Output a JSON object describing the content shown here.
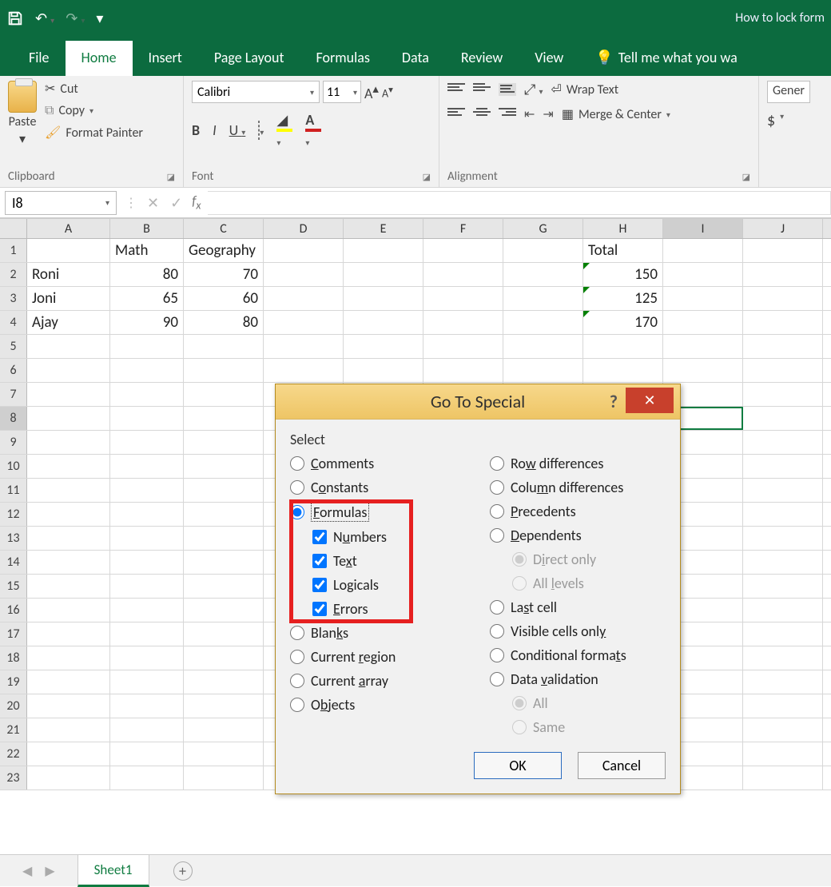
{
  "titlebar": {
    "doc_title": "How to lock form"
  },
  "tabs": {
    "file": "File",
    "home": "Home",
    "insert": "Insert",
    "page_layout": "Page Layout",
    "formulas": "Formulas",
    "data": "Data",
    "review": "Review",
    "view": "View",
    "tellme": "Tell me what you wa"
  },
  "ribbon": {
    "clipboard": {
      "label": "Clipboard",
      "paste": "Paste",
      "cut": "Cut",
      "copy": "Copy",
      "format_painter": "Format Painter"
    },
    "font": {
      "label": "Font",
      "name": "Calibri",
      "size": "11"
    },
    "alignment": {
      "label": "Alignment",
      "wrap": "Wrap Text",
      "merge": "Merge & Center"
    },
    "number": {
      "label": "Gener"
    }
  },
  "fx": {
    "namebox": "I8"
  },
  "columns": [
    "A",
    "B",
    "C",
    "D",
    "E",
    "F",
    "G",
    "H",
    "I",
    "J"
  ],
  "grid": {
    "rows": [
      {
        "rh": "1",
        "cells": [
          "",
          "Math",
          "Geography",
          "",
          "",
          "",
          "",
          "Total",
          "",
          ""
        ],
        "types": [
          "",
          "t",
          "t",
          "",
          "",
          "",
          "",
          "t",
          "",
          ""
        ]
      },
      {
        "rh": "2",
        "cells": [
          "Roni",
          "80",
          "70",
          "",
          "",
          "",
          "",
          "150",
          "",
          ""
        ],
        "types": [
          "t",
          "n",
          "n",
          "",
          "",
          "",
          "",
          "ng",
          "",
          ""
        ]
      },
      {
        "rh": "3",
        "cells": [
          "Joni",
          "65",
          "60",
          "",
          "",
          "",
          "",
          "125",
          "",
          ""
        ],
        "types": [
          "t",
          "n",
          "n",
          "",
          "",
          "",
          "",
          "ng",
          "",
          ""
        ]
      },
      {
        "rh": "4",
        "cells": [
          "Ajay",
          "90",
          "80",
          "",
          "",
          "",
          "",
          "170",
          "",
          ""
        ],
        "types": [
          "t",
          "n",
          "n",
          "",
          "",
          "",
          "",
          "ng",
          "",
          ""
        ]
      }
    ],
    "empty_rows": [
      "5",
      "6",
      "7",
      "8",
      "9",
      "10",
      "11",
      "12",
      "13",
      "14",
      "15",
      "16",
      "17",
      "18",
      "19",
      "20",
      "21",
      "22",
      "23"
    ],
    "selected_row": "8",
    "selected_col": "I"
  },
  "dialog": {
    "title": "Go To Special",
    "select": "Select",
    "left": {
      "comments": "Comments",
      "constants": "Constants",
      "formulas": "Formulas",
      "numbers": "Numbers",
      "text": "Text",
      "logicals": "Logicals",
      "errors": "Errors",
      "blanks": "Blanks",
      "current_region": "Current region",
      "current_array": "Current array",
      "objects": "Objects"
    },
    "right": {
      "row_diff": "Row differences",
      "col_diff": "Column differences",
      "precedents": "Precedents",
      "dependents": "Dependents",
      "direct_only": "Direct only",
      "all_levels": "All levels",
      "last_cell": "Last cell",
      "visible": "Visible cells only",
      "cond_fmt": "Conditional formats",
      "data_val": "Data validation",
      "all": "All",
      "same": "Same"
    },
    "ok": "OK",
    "cancel": "Cancel"
  },
  "sheets": {
    "sheet1": "Sheet1"
  }
}
